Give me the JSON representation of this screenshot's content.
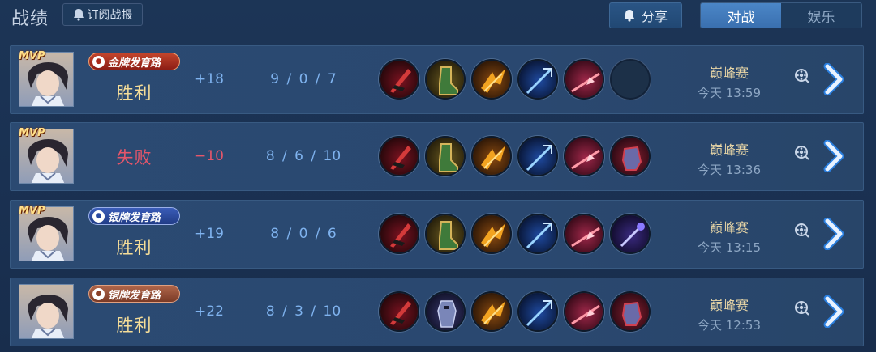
{
  "header": {
    "title": "战绩",
    "subscribe_label": "订阅战报",
    "share_label": "分享",
    "tabs": [
      {
        "label": "对战",
        "active": true
      },
      {
        "label": "娱乐",
        "active": false
      }
    ]
  },
  "colors": {
    "win": "#f5dd98",
    "lose": "#e5566a",
    "accent_blue": "#7fb3ef",
    "mode_gold": "#e7d5a6"
  },
  "matches": [
    {
      "mvp": "MVP",
      "badge": "金牌发育路",
      "badge_tier": "gold",
      "result": "胜利",
      "outcome": "win",
      "score": "+18",
      "kda": "9 / 0 / 7",
      "mode": "巅峰赛",
      "time": "今天 13:59",
      "items": [
        "red-blade-item-icon",
        "green-boots-item-icon",
        "golden-wings-item-icon",
        "blue-trident-item-icon",
        "red-spear-item-icon",
        "empty-item-slot"
      ]
    },
    {
      "mvp": "MVP",
      "badge": "",
      "badge_tier": "",
      "result": "失败",
      "outcome": "lose",
      "score": "−10",
      "kda": "8 / 6 / 10",
      "mode": "巅峰赛",
      "time": "今天 13:36",
      "items": [
        "red-blade-item-icon",
        "green-boots-item-icon",
        "golden-wings-item-icon",
        "blue-trident-item-icon",
        "red-spear-item-icon",
        "crimson-gauntlet-item-icon"
      ]
    },
    {
      "mvp": "MVP",
      "badge": "银牌发育路",
      "badge_tier": "silver",
      "result": "胜利",
      "outcome": "win",
      "score": "+19",
      "kda": "8 / 0 / 6",
      "mode": "巅峰赛",
      "time": "今天 13:15",
      "items": [
        "red-blade-item-icon",
        "green-boots-item-icon",
        "golden-wings-item-icon",
        "blue-trident-item-icon",
        "red-spear-item-icon",
        "purple-staff-item-icon"
      ]
    },
    {
      "mvp": "",
      "badge": "铜牌发育路",
      "badge_tier": "bronze",
      "result": "胜利",
      "outcome": "win",
      "score": "+22",
      "kda": "8 / 3 / 10",
      "mode": "巅峰赛",
      "time": "今天 12:53",
      "items": [
        "red-blade-item-icon",
        "armored-knight-item-icon",
        "golden-wings-item-icon",
        "blue-trident-item-icon",
        "red-spear-item-icon",
        "crimson-gauntlet-item-icon"
      ]
    }
  ]
}
